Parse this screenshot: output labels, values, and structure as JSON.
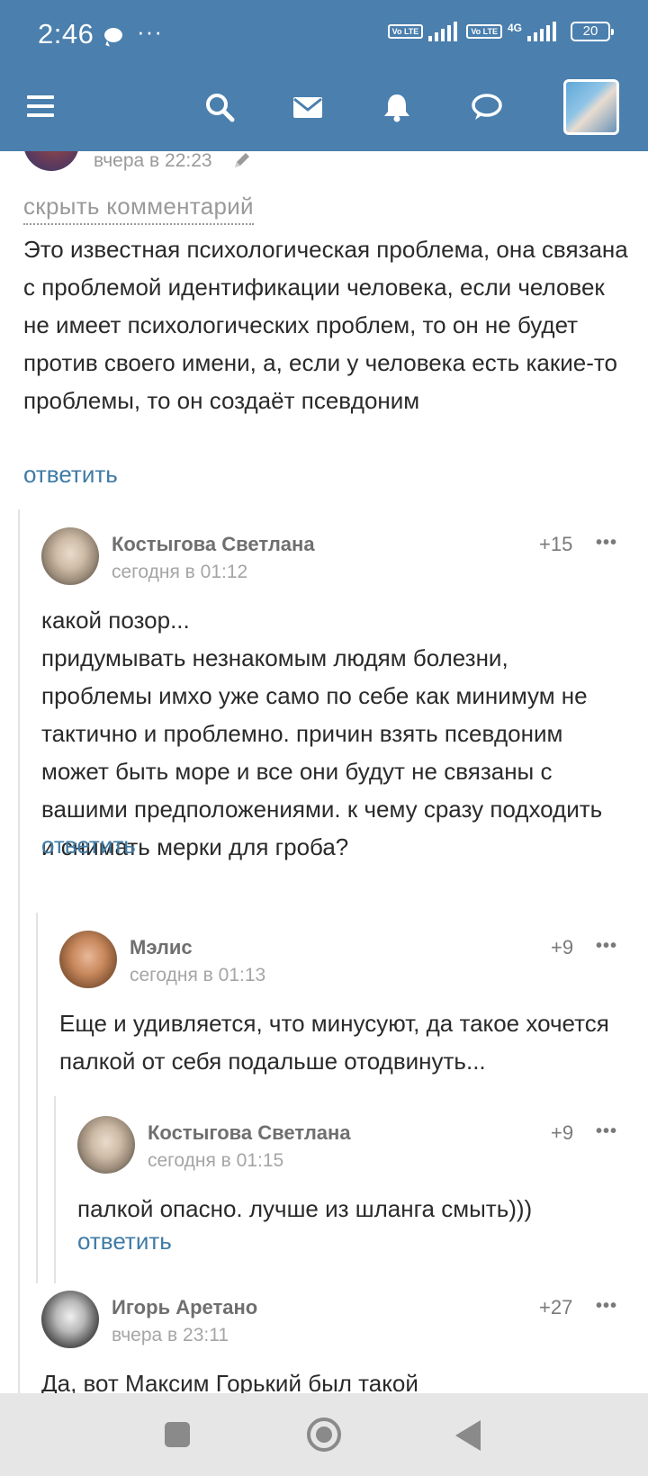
{
  "status_bar": {
    "time": "2:46",
    "dots": "···",
    "volte_1": "Vo LTE",
    "volte_2": "Vo LTE",
    "network": "4G",
    "battery": "20"
  },
  "header": {
    "icons": [
      "menu-icon",
      "search-icon",
      "mail-icon",
      "bell-icon",
      "chat-icon",
      "profile-avatar"
    ],
    "accent_color": "#4a7fae"
  },
  "previous_comment": {
    "time": "вчера в 22:23",
    "hide_label": "скрыть комментарий",
    "text": "Это известная психологическая проблема, она связана с проблемой идентификации человека, если человек не имеет психологических проблем, то он не будет против своего имени, а, если у человека есть какие-то проблемы, то он создаёт псевдоним",
    "reply_label": "ответить"
  },
  "comments": [
    {
      "author": "Костыгова Светлана",
      "time": "сегодня в 01:12",
      "score": "+15",
      "more": "•••",
      "text": "какой позор...\nпридумывать незнакомым людям болезни, проблемы имхо уже само по себе как минимум не тактично и проблемно. причин взять псевдоним может быть море и все они будут не связаны с вашими предположениями. к чему сразу подходить и снимать мерки для гроба?",
      "reply_label": "ответить"
    },
    {
      "author": "Мэлис",
      "time": "сегодня в 01:13",
      "score": "+9",
      "more": "•••",
      "text": "Еще и удивляется, что минусуют, да такое хочется палкой от себя подальше отодвинуть..."
    },
    {
      "author": "Костыгова Светлана",
      "time": "сегодня в 01:15",
      "score": "+9",
      "more": "•••",
      "text": "палкой опасно. лучше из шланга смыть)))",
      "reply_label": "ответить"
    },
    {
      "author": "Игорь Аретано",
      "time": "вчера в 23:11",
      "score": "+27",
      "more": "•••",
      "text": "Да, вот Максим Горький был такой"
    }
  ],
  "link_color": "#3f7ba6"
}
